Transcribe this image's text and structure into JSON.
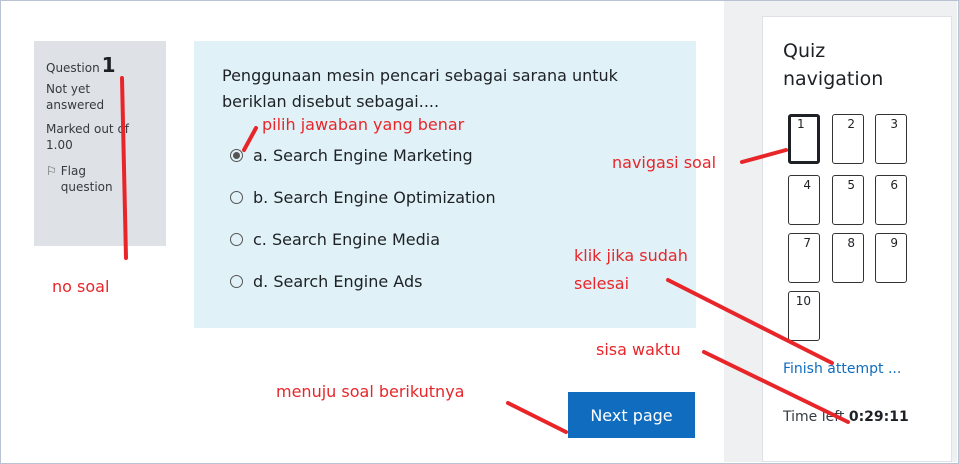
{
  "question_info": {
    "label": "Question",
    "number": "1",
    "state": "Not yet answered",
    "grade": "Marked out of 1.00",
    "flag_label": "Flag question",
    "flag_icon": "flag-icon"
  },
  "question": {
    "text": "Penggunaan mesin pencari sebagai sarana untuk beriklan disebut sebagai....",
    "answers": [
      {
        "label": "a. Search Engine Marketing",
        "checked": true
      },
      {
        "label": "b. Search Engine Optimization",
        "checked": false
      },
      {
        "label": "c. Search Engine Media",
        "checked": false
      },
      {
        "label": "d. Search Engine Ads",
        "checked": false
      }
    ]
  },
  "next_button": "Next page",
  "quiz_nav": {
    "title": "Quiz navigation",
    "buttons": [
      "1",
      "2",
      "3",
      "4",
      "5",
      "6",
      "7",
      "8",
      "9",
      "10"
    ],
    "current": "1",
    "finish_link": "Finish attempt ...",
    "time_left_label": "Time left",
    "time_left_value": "0:29:11"
  },
  "annotations": {
    "pilih": "pilih jawaban yang benar",
    "navigasi": "navigasi soal",
    "klik": "klik jika sudah selesai",
    "klik_line1": "klik jika sudah",
    "klik_line2": "selesai",
    "no_soal": "no soal",
    "sisa_waktu": "sisa waktu",
    "menuju": "menuju soal berikutnya",
    "color": "#e8262a"
  },
  "colors": {
    "primary": "#0f6cbf",
    "question_bg": "#e0f2f7",
    "info_bg": "#dee2e6",
    "sidebar_bg": "#eef0f2"
  }
}
